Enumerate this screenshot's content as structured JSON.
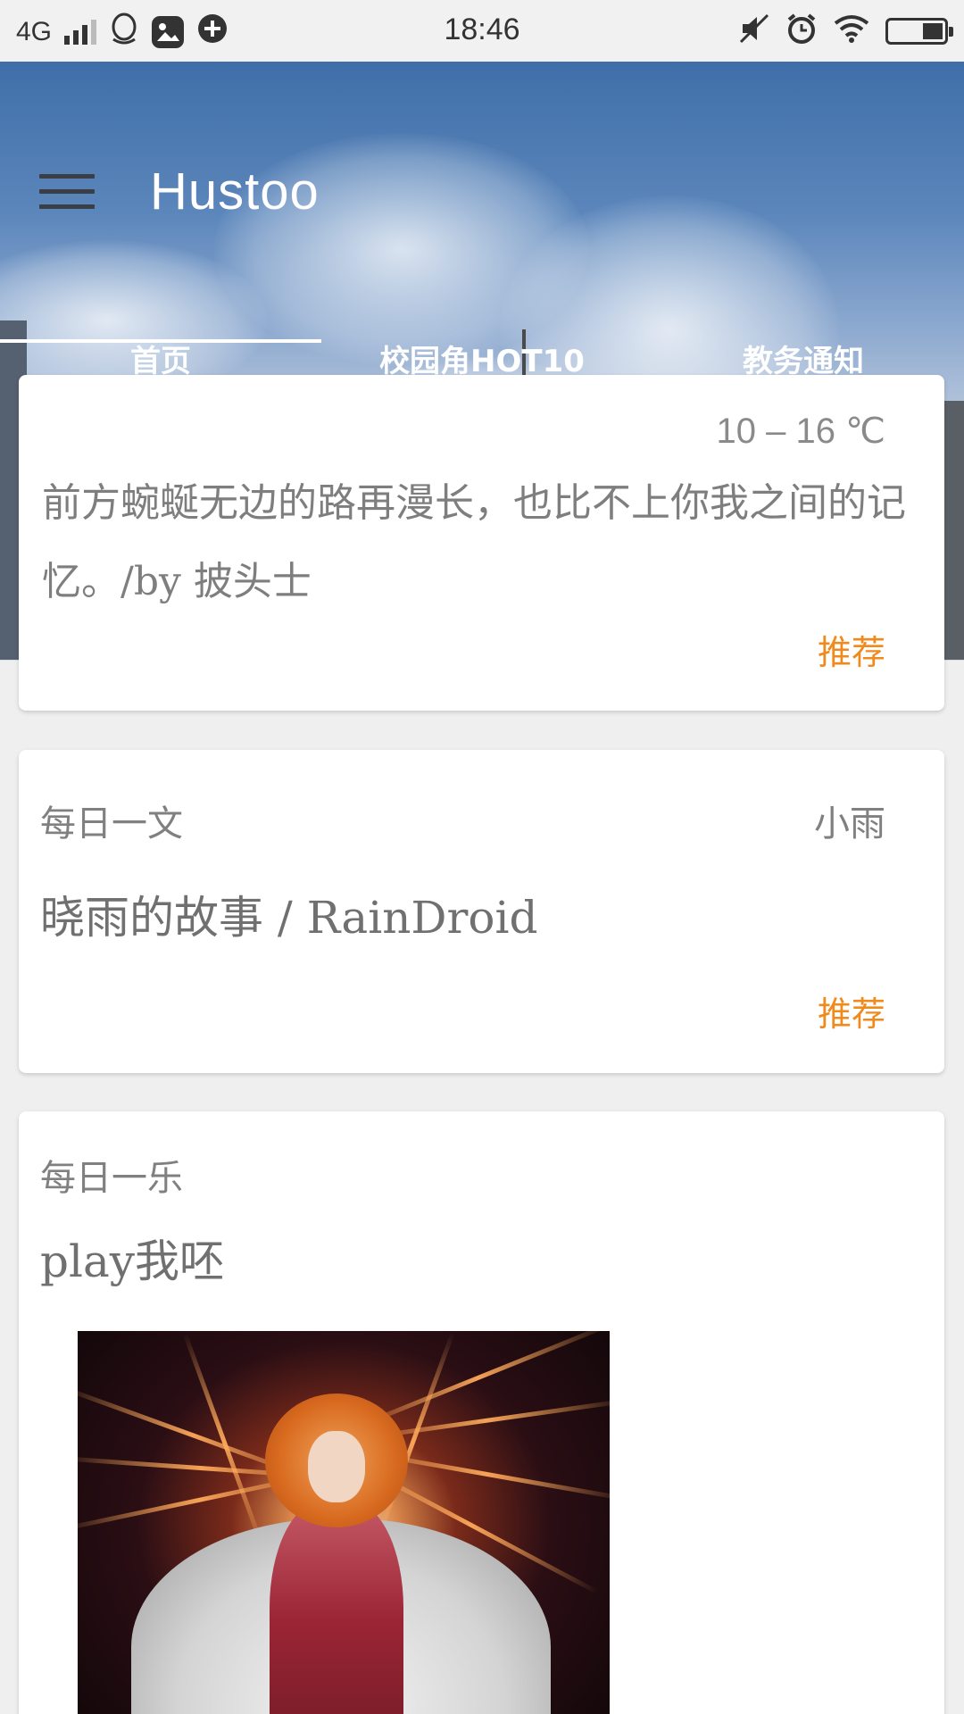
{
  "status_bar": {
    "network": "4G",
    "time": "18:46"
  },
  "header": {
    "app_title": "Hustoo"
  },
  "tabs": [
    {
      "label": "首页",
      "selected": true
    },
    {
      "label": "校园角HOT10",
      "selected": false
    },
    {
      "label": "教务通知",
      "selected": false
    }
  ],
  "weather_card": {
    "temperature": "10 – 16 ℃",
    "quote": "前方蜿蜒无边的路再漫长，也比不上你我之间的记忆。/by 披头士",
    "action": "推荐"
  },
  "article_card": {
    "section": "每日一文",
    "author": "小雨",
    "title": "晓雨的故事 / RainDroid",
    "action": "推荐"
  },
  "music_card": {
    "section": "每日一乐",
    "title": "play我呸"
  },
  "colors": {
    "accent": "#f08a1c",
    "card_background": "#ffffff",
    "page_background": "#efefef",
    "muted_text": "#808080"
  }
}
